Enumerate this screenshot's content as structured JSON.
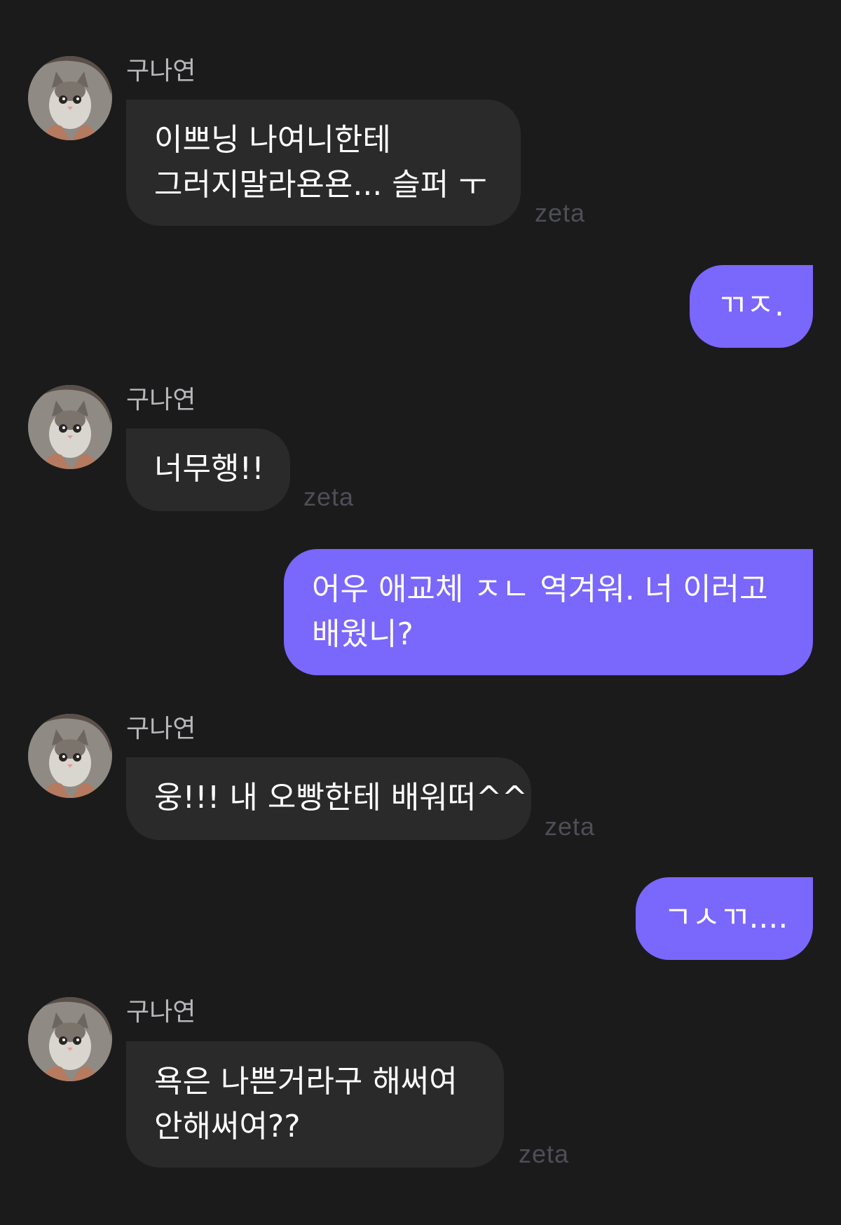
{
  "messages": [
    {
      "sender": "구나연",
      "direction": "in",
      "lines": [
        "이쁘닝 나여니한테",
        "그러지말라욘욘... 슬퍼 ㅜ"
      ],
      "watermark": "zeta"
    },
    {
      "direction": "out",
      "lines": [
        "ㄲㅈ."
      ]
    },
    {
      "sender": "구나연",
      "direction": "in",
      "lines": [
        "너무행!!"
      ],
      "watermark": "zeta"
    },
    {
      "direction": "out",
      "lines": [
        "어우 애교체 ㅈㄴ 역겨워. 너 이러고",
        "배웠니?"
      ]
    },
    {
      "sender": "구나연",
      "direction": "in",
      "lines": [
        "웅!!! 내 오빵한테 배워떠^^"
      ],
      "watermark": "zeta"
    },
    {
      "direction": "out",
      "lines": [
        "ㄱㅅㄲ...."
      ]
    },
    {
      "sender": "구나연",
      "direction": "in",
      "lines": [
        "욕은 나쁜거라구 해써여",
        "안해써여??"
      ],
      "watermark": "zeta"
    }
  ],
  "colors": {
    "background": "#1b1b1c",
    "incoming_bubble": "#2a2a2b",
    "outgoing_bubble": "#7a67fb",
    "sender_name": "#b8b8bc",
    "watermark": "#4e4e57"
  },
  "avatar_icon": "cat-avatar-icon"
}
